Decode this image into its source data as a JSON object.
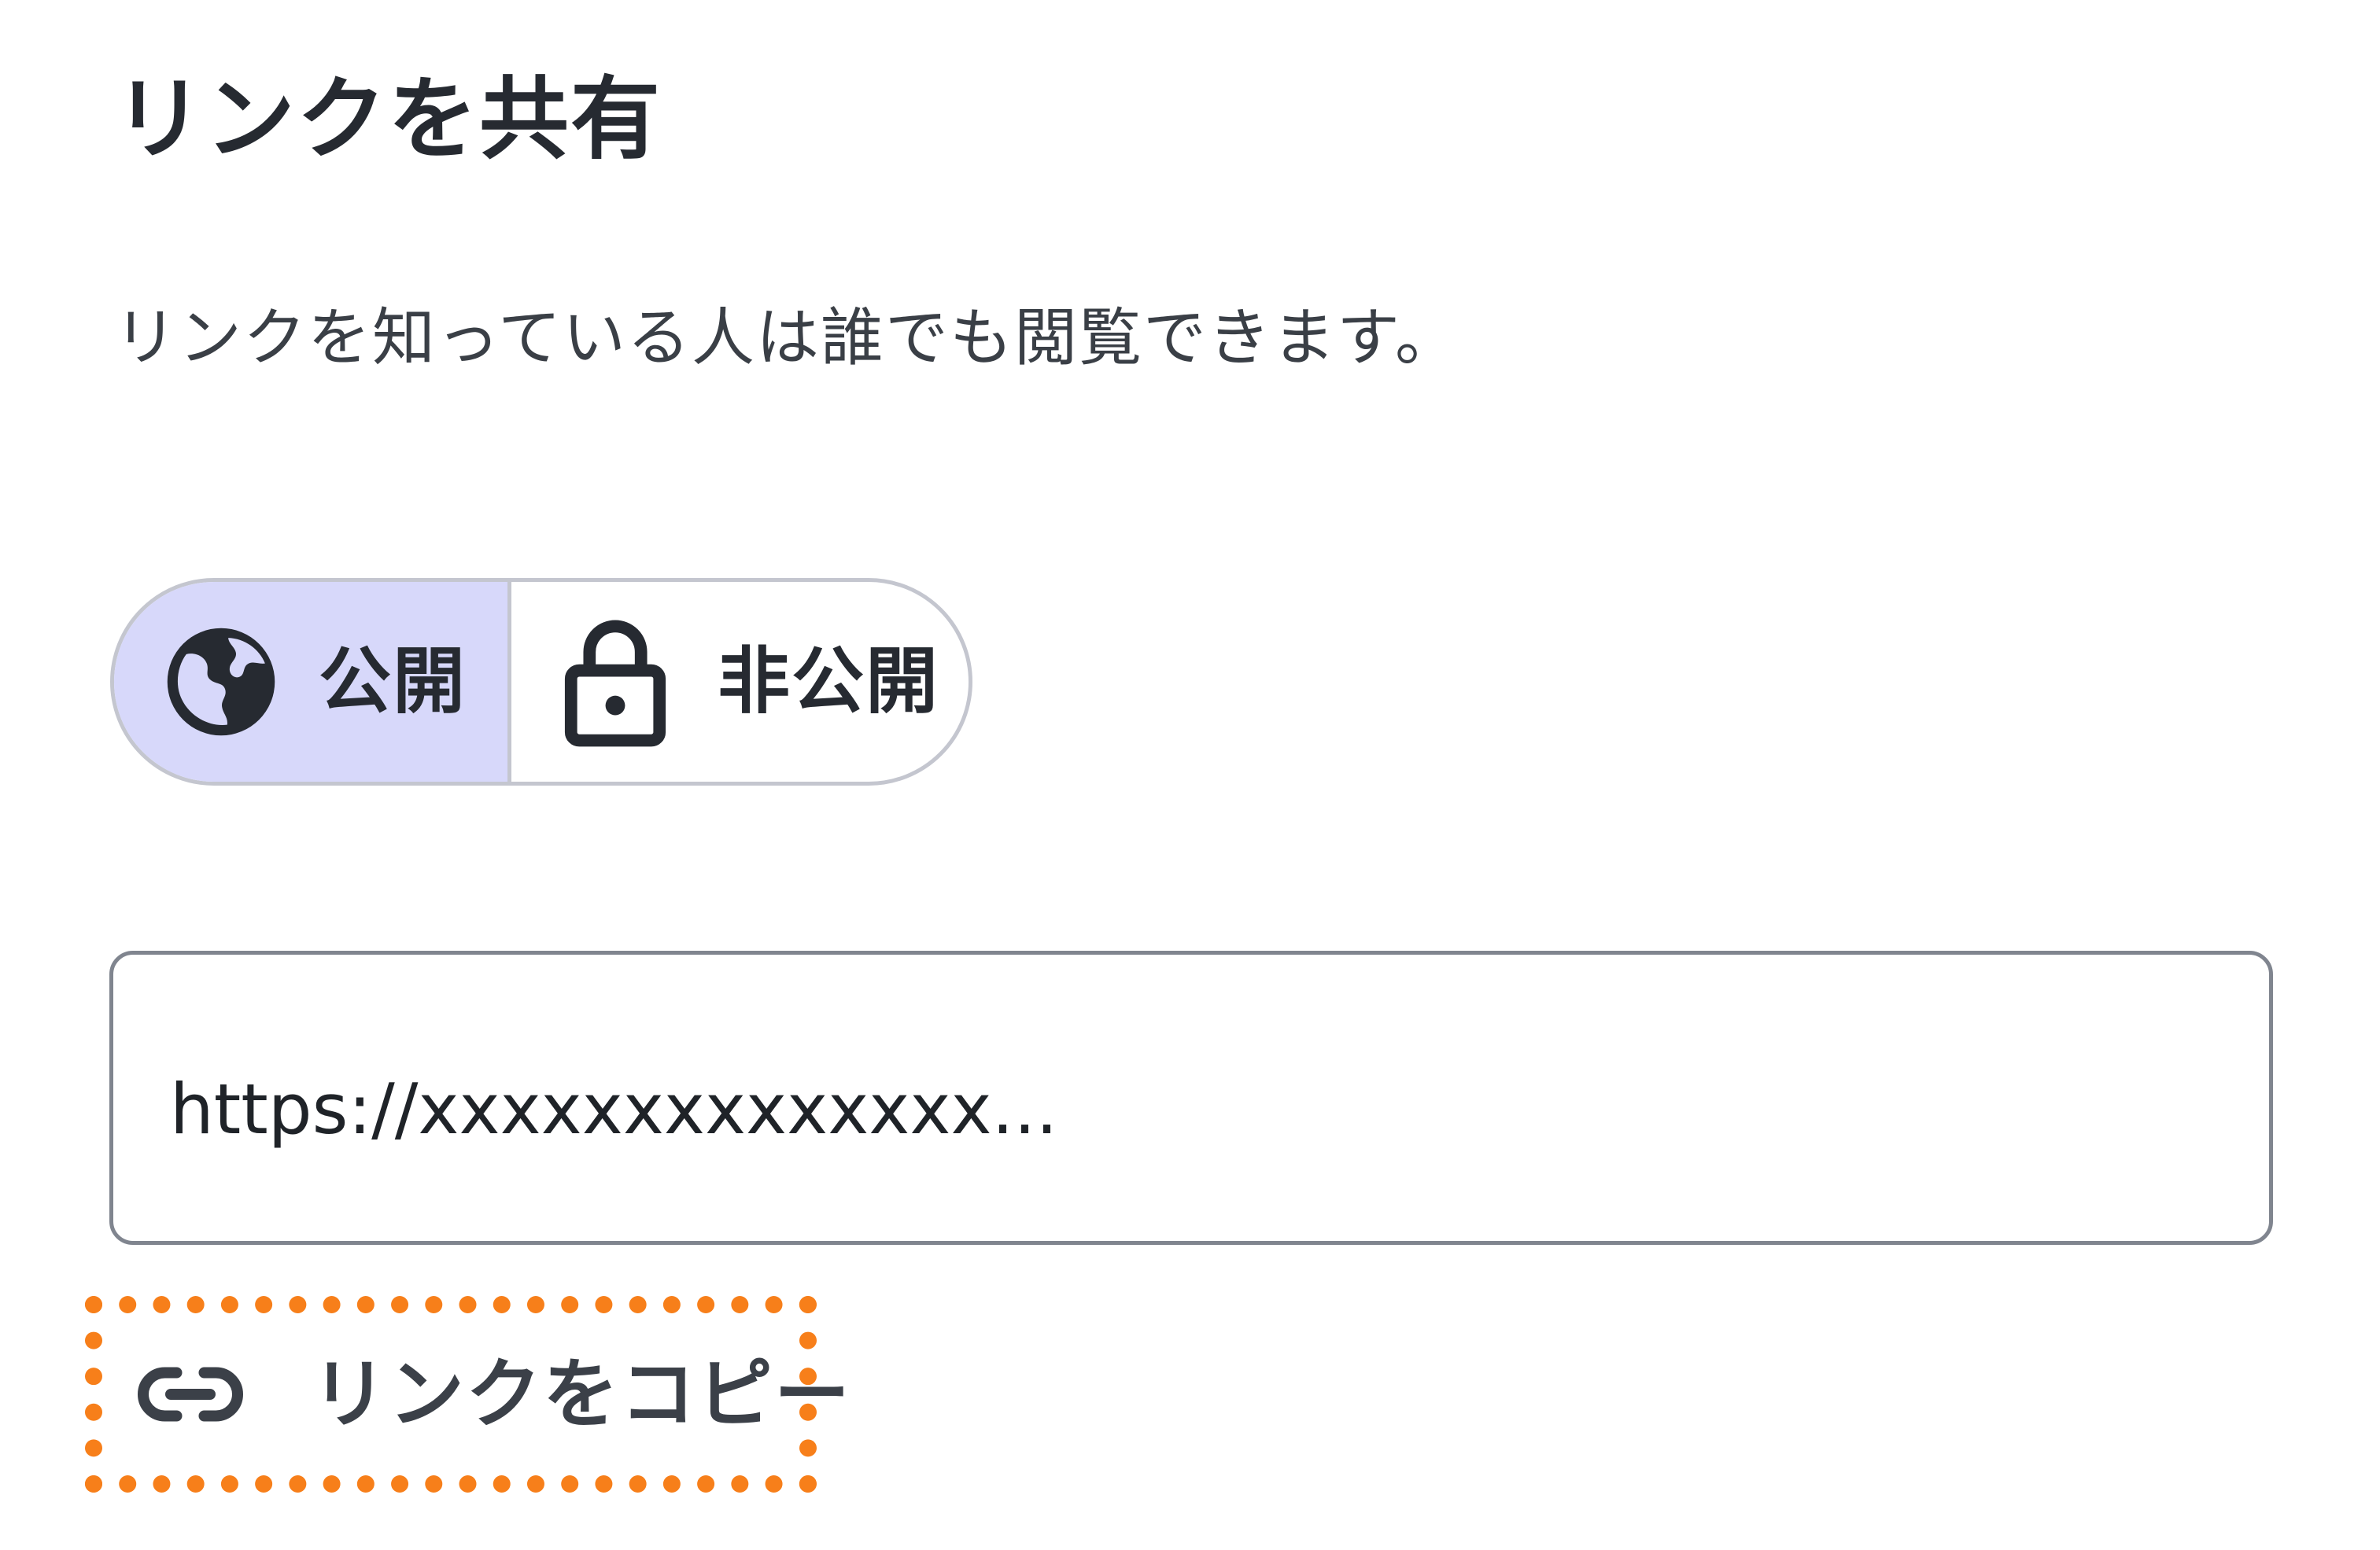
{
  "dialog": {
    "title": "リンクを共有",
    "description": "リンクを知っている人は誰でも閲覧できます。"
  },
  "visibility_toggle": {
    "selected": "public",
    "options": [
      {
        "id": "public",
        "label": "公開",
        "icon": "globe-icon"
      },
      {
        "id": "private",
        "label": "非公開",
        "icon": "lock-icon"
      }
    ]
  },
  "url_field": {
    "value": "https://xxxxxxxxxxxxxx..."
  },
  "copy_link": {
    "label": "リンクをコピー",
    "icon": "link-icon"
  },
  "colors": {
    "selected_background": "#d7d8fa",
    "highlight_border": "#f77f1a",
    "text": "#262a31"
  }
}
